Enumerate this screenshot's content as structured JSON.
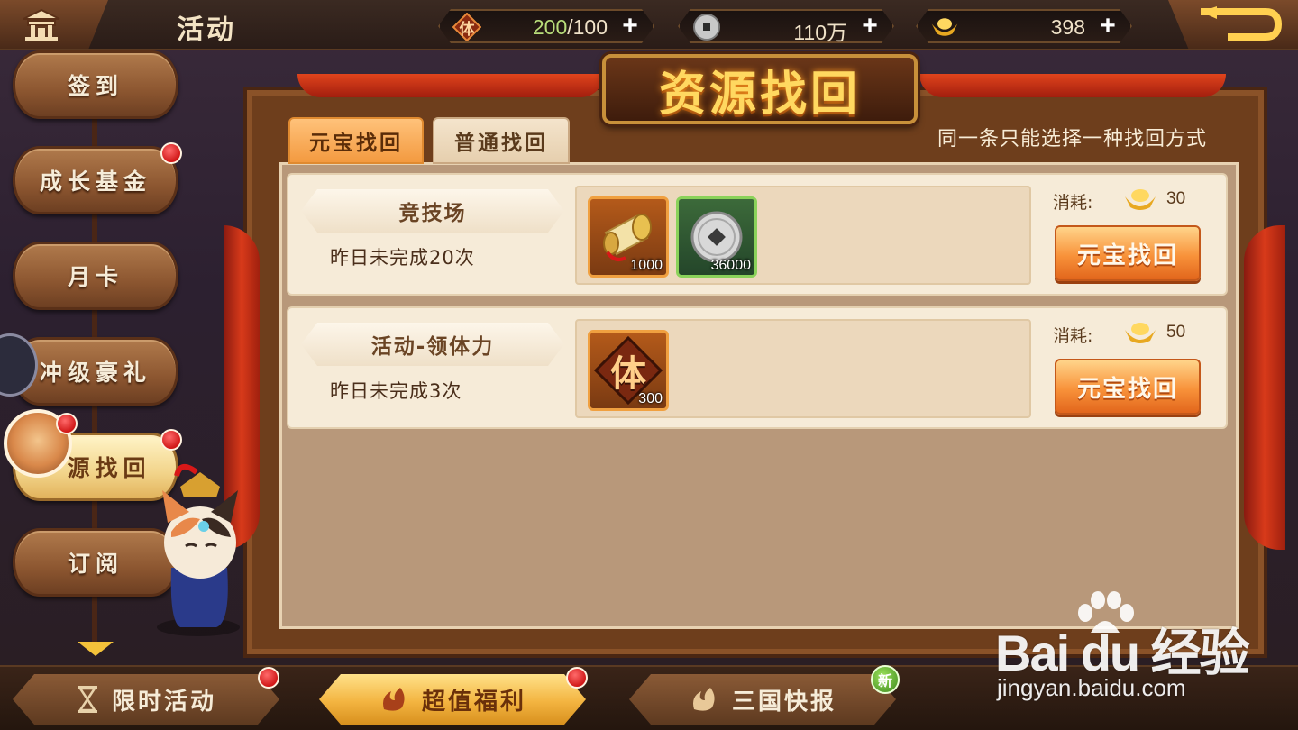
{
  "header": {
    "title": "活动",
    "stamina": {
      "icon_char": "体",
      "current": "200",
      "max": "/100",
      "plus": "+"
    },
    "coins": {
      "value": "110万",
      "plus": "+",
      "icon": "copper-coin-icon"
    },
    "ingots": {
      "value": "398",
      "plus": "+",
      "icon": "gold-ingot-icon"
    }
  },
  "sidebar": {
    "items": [
      {
        "label": "签到",
        "badge": false
      },
      {
        "label": "成长基金",
        "badge": true
      },
      {
        "label": "月卡",
        "badge": false
      },
      {
        "label": "冲级豪礼",
        "badge": false
      },
      {
        "label": "源找回",
        "badge": true,
        "active": true
      },
      {
        "label": "订阅",
        "badge": false
      }
    ]
  },
  "panel": {
    "title": "资源找回",
    "tabs": [
      {
        "label": "元宝找回",
        "active": true
      },
      {
        "label": "普通找回",
        "active": false
      }
    ],
    "hint": "同一条只能选择一种找回方式",
    "rows": [
      {
        "name": "竞技场",
        "note": "昨日未完成20次",
        "rewards": [
          {
            "icon": "scroll-item-icon",
            "qty": "1000",
            "frame": "orange"
          },
          {
            "icon": "silver-coin-icon",
            "qty": "36000",
            "frame": "green"
          }
        ],
        "cost_label": "消耗:",
        "cost_value": "30",
        "button": "元宝找回"
      },
      {
        "name": "活动-领体力",
        "note": "昨日未完成3次",
        "rewards": [
          {
            "icon": "stamina-item-icon",
            "icon_char": "体",
            "qty": "300",
            "frame": "orange"
          }
        ],
        "cost_label": "消耗:",
        "cost_value": "50",
        "button": "元宝找回"
      }
    ]
  },
  "bottom": {
    "buttons": [
      {
        "label": "限时活动",
        "icon": "hourglass-icon",
        "badge": true
      },
      {
        "label": "超值福利",
        "icon": "fire-swirl-icon",
        "badge": true,
        "active": true
      },
      {
        "label": "三国快报",
        "icon": "scroll-swirl-icon",
        "badge_new": "新"
      }
    ]
  },
  "watermark": {
    "logo": "Bai du 经验",
    "url": "jingyan.baidu.com"
  },
  "colors": {
    "accent_orange": "#f8923a",
    "gold": "#ffd860",
    "badge_red": "#d11818",
    "badge_green": "#3e8a1e"
  }
}
